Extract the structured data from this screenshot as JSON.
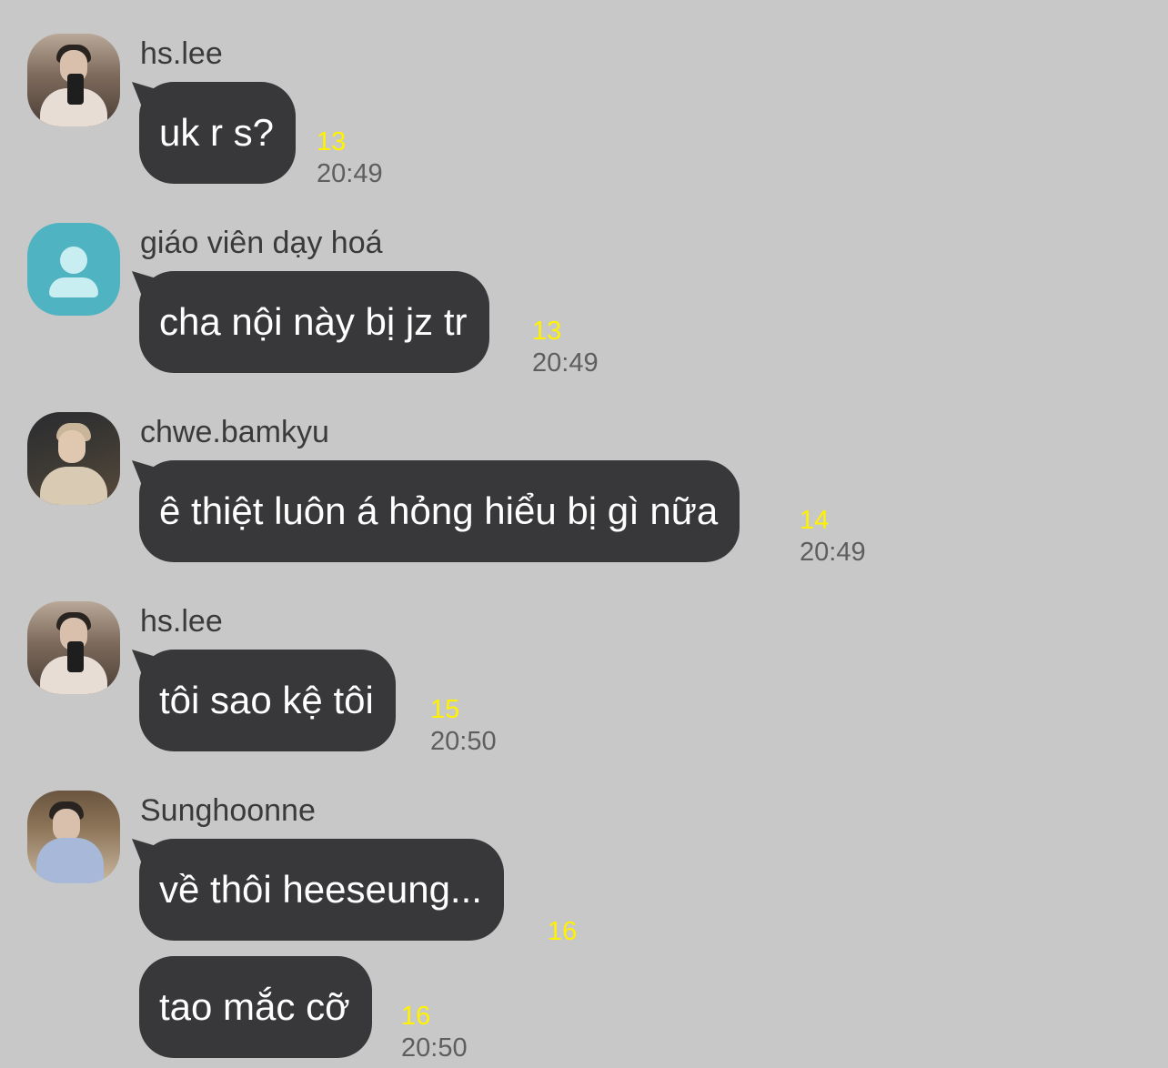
{
  "messages": [
    {
      "sender": "hs.lee",
      "text": "uk r s?",
      "unread": "13",
      "time": "20:49",
      "avatar": "photo-avatar"
    },
    {
      "sender": "giáo viên dạy hoá",
      "text": "cha nội này bị jz tr",
      "unread": "13",
      "time": "20:49",
      "avatar": "default-avatar"
    },
    {
      "sender": "chwe.bamkyu",
      "text": "ê thiệt luôn á hỏng hiểu bị gì nữa",
      "unread": "14",
      "time": "20:49",
      "avatar": "photo-avatar"
    },
    {
      "sender": "hs.lee",
      "text": "tôi sao kệ tôi",
      "unread": "15",
      "time": "20:50",
      "avatar": "photo-avatar"
    },
    {
      "sender": "Sunghoonne",
      "text": "về thôi heeseung...",
      "unread": "16",
      "avatar": "photo-avatar"
    },
    {
      "text": "tao mắc cỡ",
      "unread": "16",
      "time": "20:50"
    }
  ],
  "colors": {
    "background": "#c8c8c8",
    "bubble": "#38383b",
    "unread": "#fff200",
    "time": "#5e5e5e",
    "default_avatar": "#4fb3c2"
  }
}
